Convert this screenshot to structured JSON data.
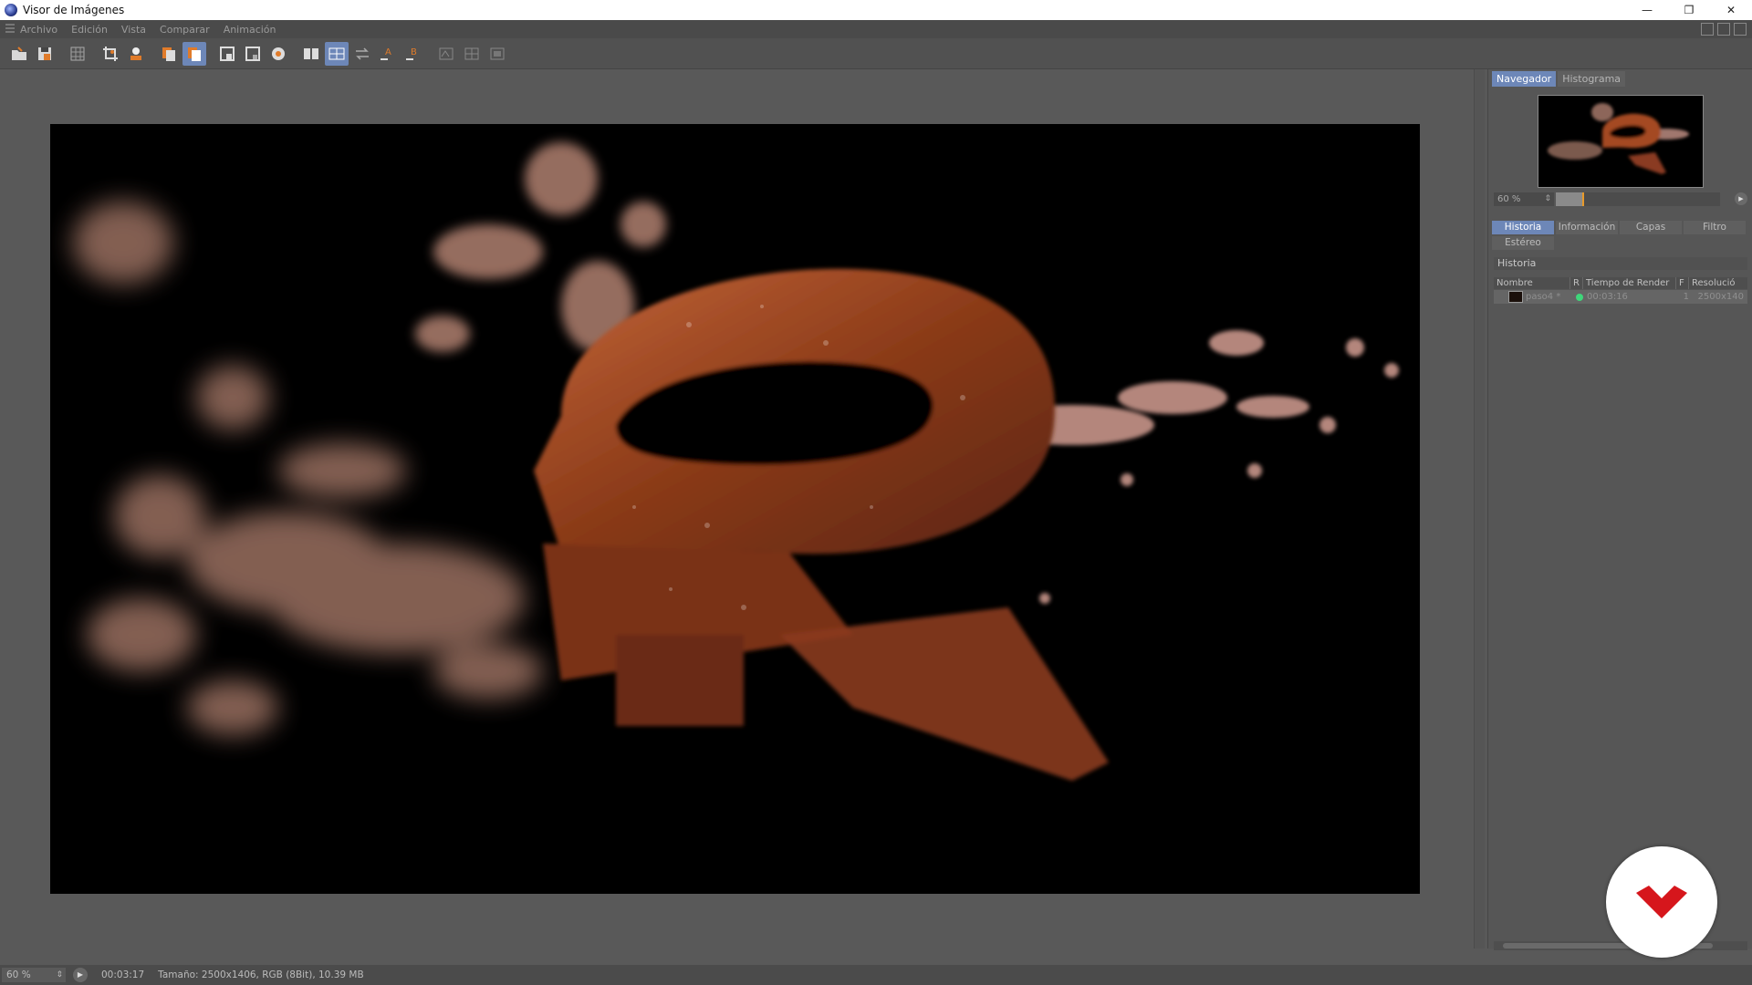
{
  "window": {
    "title": "Visor de Imágenes",
    "controls": [
      "—",
      "❐",
      "✕"
    ]
  },
  "menu": {
    "items": [
      "Archivo",
      "Edición",
      "Vista",
      "Comparar",
      "Animación"
    ]
  },
  "navigator": {
    "tabs": [
      "Navegador",
      "Histograma"
    ],
    "zoom_label": "60 %",
    "zoom_level_fraction": 0.16
  },
  "info_tabs": [
    "Historia",
    "Información",
    "Capas",
    "Filtro",
    "Estéreo"
  ],
  "history": {
    "section_title": "Historia",
    "columns": [
      "Nombre",
      "R",
      "Tiempo de Render",
      "F",
      "Resolució"
    ],
    "rows": [
      {
        "name": "paso4 *",
        "time": "00:03:16",
        "frame": "1",
        "resolution": "2500x140"
      }
    ]
  },
  "status": {
    "zoom": "60 %",
    "time": "00:03:17",
    "info": "Tamaño: 2500x1406, RGB (8Bit), 10.39 MB"
  },
  "colors": {
    "accent": "#6d87b8",
    "status_ok": "#3fd67a",
    "logo_red": "#d6161c"
  }
}
